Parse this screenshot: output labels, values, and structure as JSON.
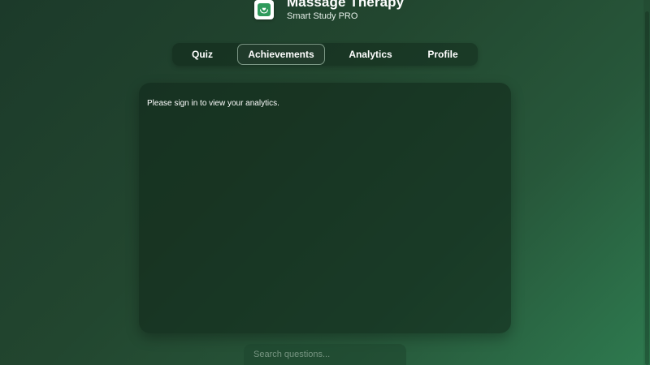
{
  "app": {
    "title": "Massage Therapy",
    "subtitle": "Smart Study PRO",
    "logo_icon": "hands-heart-icon"
  },
  "nav": {
    "tabs": [
      {
        "label": "Quiz",
        "active": false
      },
      {
        "label": "Achievements",
        "active": true
      },
      {
        "label": "Analytics",
        "active": false
      },
      {
        "label": "Profile",
        "active": false
      }
    ]
  },
  "panel": {
    "message": "Please sign in to view your analytics."
  },
  "search": {
    "value": "",
    "placeholder": "Search questions..."
  },
  "colors": {
    "background_start": "#1c3a2a",
    "background_end": "#2e7a4f",
    "logo_accent": "#2f9a5c",
    "text": "#ffffff"
  }
}
